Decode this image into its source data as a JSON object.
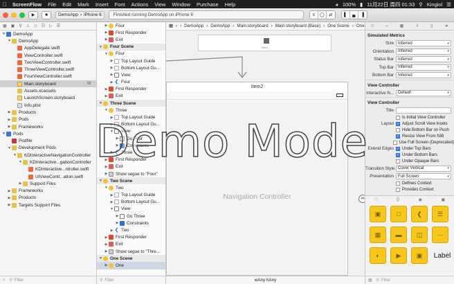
{
  "menubar": {
    "app": "ScreenFlow",
    "items": [
      "File",
      "Edit",
      "Mark",
      "Insert",
      "Font",
      "Actions",
      "View",
      "Window",
      "Purchase",
      "Help"
    ],
    "battery": "100%",
    "datetime": "11月22日 周四 01:33",
    "user": "Kingiol"
  },
  "toolbar": {
    "scheme": "DemoApp",
    "device": "iPhone 6",
    "activity": "Finished running DemoApp on iPhone 6"
  },
  "navigator": {
    "rows": [
      {
        "label": "DemoApp",
        "level": 0,
        "type": "xc",
        "open": true
      },
      {
        "label": "DemoApp",
        "level": 1,
        "type": "folder",
        "open": true
      },
      {
        "label": "AppDelegate.swift",
        "level": 2,
        "type": "swift"
      },
      {
        "label": "ViewController.swift",
        "level": 2,
        "type": "swift"
      },
      {
        "label": "TwoViewController.swift",
        "level": 2,
        "type": "swift"
      },
      {
        "label": "ThreeViewController.swift",
        "level": 2,
        "type": "swift"
      },
      {
        "label": "FourViewController.swift",
        "level": 2,
        "type": "swift"
      },
      {
        "label": "Main.storyboard",
        "level": 2,
        "type": "sb",
        "selected": true,
        "badge": "M"
      },
      {
        "label": "Assets.xcassets",
        "level": 2,
        "type": "folder"
      },
      {
        "label": "LaunchScreen.storyboard",
        "level": 2,
        "type": "sb"
      },
      {
        "label": "Info.plist",
        "level": 2,
        "type": "plist"
      },
      {
        "label": "Products",
        "level": 1,
        "type": "folder",
        "closed": true
      },
      {
        "label": "Pods",
        "level": 1,
        "type": "folder",
        "closed": true
      },
      {
        "label": "Frameworks",
        "level": 1,
        "type": "folder",
        "closed": true
      },
      {
        "label": "Pods",
        "level": 0,
        "type": "xc",
        "open": true
      },
      {
        "label": "Podfile",
        "level": 1,
        "type": "pod"
      },
      {
        "label": "Development Pods",
        "level": 1,
        "type": "folder",
        "open": true
      },
      {
        "label": "KDInteractiveNavigationController",
        "level": 2,
        "type": "folder",
        "open": true
      },
      {
        "label": "KDInteractive...gationController",
        "level": 3,
        "type": "folder",
        "open": true
      },
      {
        "label": "KDInteractive...ntroller.swift",
        "level": 4,
        "type": "swift"
      },
      {
        "label": "UIViewContr...ation.swift",
        "level": 4,
        "type": "swift"
      },
      {
        "label": "Support Files",
        "level": 3,
        "type": "folder",
        "closed": true
      },
      {
        "label": "Frameworks",
        "level": 1,
        "type": "folder",
        "closed": true
      },
      {
        "label": "Products",
        "level": 1,
        "type": "folder",
        "closed": true
      },
      {
        "label": "Targets Support Files",
        "level": 1,
        "type": "folder",
        "closed": true
      }
    ],
    "filter_placeholder": "Filter"
  },
  "outline": {
    "rows": [
      {
        "label": "Four",
        "level": 1,
        "icon": "vc"
      },
      {
        "label": "First Responder",
        "level": 1,
        "icon": "fr"
      },
      {
        "label": "Exit",
        "level": 1,
        "icon": "ex"
      },
      {
        "label": "Four Scene",
        "level": 0,
        "scene": true
      },
      {
        "label": "Four",
        "level": 1,
        "icon": "vc",
        "open": true
      },
      {
        "label": "Top Layout Guide",
        "level": 2,
        "icon": "lay"
      },
      {
        "label": "Bottom Layout Gu...",
        "level": 2,
        "icon": "lay"
      },
      {
        "label": "View",
        "level": 2,
        "icon": "view"
      },
      {
        "label": "Four",
        "level": 2,
        "icon": "item"
      },
      {
        "label": "First Responder",
        "level": 1,
        "icon": "fr"
      },
      {
        "label": "Exit",
        "level": 1,
        "icon": "ex"
      },
      {
        "label": "Three Scene",
        "level": 0,
        "scene": true
      },
      {
        "label": "Three",
        "level": 1,
        "icon": "vc",
        "open": true
      },
      {
        "label": "Top Layout Guide",
        "level": 2,
        "icon": "lay"
      },
      {
        "label": "Bottom Layout Gu...",
        "level": 2,
        "icon": "lay"
      },
      {
        "label": "View",
        "level": 2,
        "icon": "view",
        "open": true
      },
      {
        "label": "Go Four",
        "level": 3,
        "icon": "view"
      },
      {
        "label": "Constraints",
        "level": 3,
        "icon": "nav"
      },
      {
        "label": "Three",
        "level": 2,
        "icon": "item"
      },
      {
        "label": "First Responder",
        "level": 1,
        "icon": "fr"
      },
      {
        "label": "Exit",
        "level": 1,
        "icon": "ex"
      },
      {
        "label": "Show segue to \"Four\"",
        "level": 1,
        "icon": "seg"
      },
      {
        "label": "Two Scene",
        "level": 0,
        "scene": true
      },
      {
        "label": "Two",
        "level": 1,
        "icon": "vc",
        "open": true
      },
      {
        "label": "Top Layout Guide",
        "level": 2,
        "icon": "lay"
      },
      {
        "label": "Bottom Layout Gu...",
        "level": 2,
        "icon": "lay"
      },
      {
        "label": "View",
        "level": 2,
        "icon": "view",
        "open": true
      },
      {
        "label": "Go Three",
        "level": 3,
        "icon": "view"
      },
      {
        "label": "Constraints",
        "level": 3,
        "icon": "nav"
      },
      {
        "label": "Two",
        "level": 2,
        "icon": "item"
      },
      {
        "label": "First Responder",
        "level": 1,
        "icon": "fr"
      },
      {
        "label": "Exit",
        "level": 1,
        "icon": "ex"
      },
      {
        "label": "Show segue to \"Thre...",
        "level": 1,
        "icon": "seg"
      },
      {
        "label": "One Scene",
        "level": 0,
        "scene": true
      },
      {
        "label": "One",
        "level": 1,
        "icon": "vc",
        "selected": true
      }
    ],
    "filter_placeholder": "Filter"
  },
  "canvas": {
    "breadcrumbs": [
      "DemoApp",
      "DemoApp",
      "Main.storyboard",
      "Main.storyboard (Base)",
      "One Scene",
      "One"
    ],
    "top_scene_label": "Item1",
    "nav_scene_title": "Item2",
    "nav_controller_label": "Navigation Controller",
    "size_class": "wAny hAny"
  },
  "inspector": {
    "simulated_metrics_title": "Simulated Metrics",
    "metrics": [
      {
        "label": "Size",
        "value": "Inferred"
      },
      {
        "label": "Orientation",
        "value": "Inferred"
      },
      {
        "label": "Status Bar",
        "value": "Inferred"
      },
      {
        "label": "Top Bar",
        "value": "Inferred"
      },
      {
        "label": "Bottom Bar",
        "value": "Inferred"
      }
    ],
    "view_controller_title": "View Controller",
    "interactive_label": "Interactive N...",
    "interactive_value": "Default",
    "vc_title": "View Controller",
    "title_label": "Title",
    "initial_vc": "Is Initial View Controller",
    "layout_label": "Layout",
    "layout_options": [
      {
        "label": "Adjust Scroll View Insets",
        "on": true
      },
      {
        "label": "Hide Bottom Bar on Push",
        "on": false
      },
      {
        "label": "Resize View From NIB",
        "on": true
      },
      {
        "label": "Use Full Screen (Deprecated)",
        "on": false
      }
    ],
    "extend_label": "Extend Edges",
    "extend_options": [
      {
        "label": "Under Top Bars",
        "on": true
      },
      {
        "label": "Under Bottom Bars",
        "on": true
      },
      {
        "label": "Under Opaque Bars",
        "on": false
      }
    ],
    "transition_label": "Transition Style",
    "transition_value": "Cover Vertical",
    "presentation_label": "Presentation",
    "presentation_value": "Full Screen",
    "defines_context": "Defines Context",
    "provides_context": "Provides Context",
    "library_label": "Label",
    "filter_placeholder": "Filter"
  },
  "overlay": {
    "text": "Demo Mode"
  }
}
